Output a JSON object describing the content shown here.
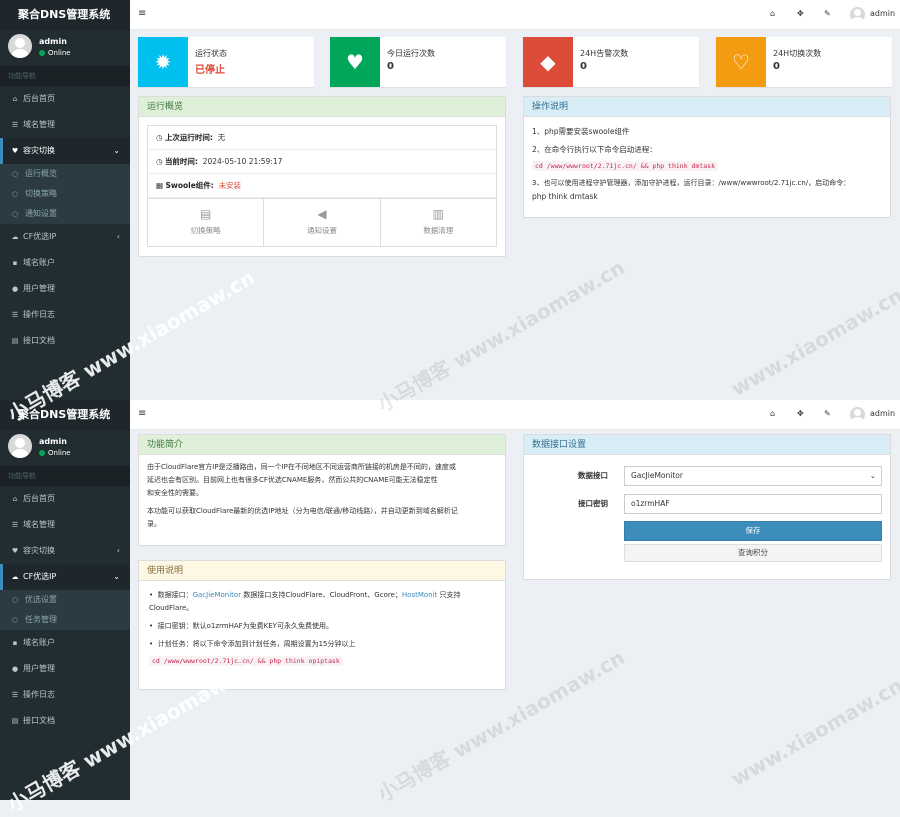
{
  "app": {
    "title": "聚合DNS管理系统",
    "user_name": "admin",
    "user_status": "Online",
    "nav_header": "功能导航",
    "topbar_user": "admin"
  },
  "icons": {
    "menu": "menu-icon",
    "home": "home-icon",
    "fullscreen": "expand-icon",
    "settings": "wrench-icon"
  },
  "screen1": {
    "nav": [
      {
        "label": "后台首页",
        "icon": "home-icon"
      },
      {
        "label": "域名管理",
        "icon": "list-icon"
      },
      {
        "label": "容灾切换",
        "icon": "heart-icon",
        "expanded": true
      },
      {
        "label": "CF优选IP",
        "icon": "cloud-icon"
      },
      {
        "label": "域名账户",
        "icon": "lock-icon"
      },
      {
        "label": "用户管理",
        "icon": "user-icon"
      },
      {
        "label": "操作日志",
        "icon": "list-icon"
      },
      {
        "label": "接口文档",
        "icon": "doc-icon"
      }
    ],
    "subnav": [
      {
        "label": "运行概览",
        "active": true
      },
      {
        "label": "切换策略",
        "active": false
      },
      {
        "label": "通知设置",
        "active": false
      }
    ],
    "info_boxes": [
      {
        "title": "运行状态",
        "value": "已停止",
        "color": "#00c0ef",
        "icon": "gear-icon"
      },
      {
        "title": "今日运行次数",
        "value": "0",
        "color": "#00a65a",
        "icon": "heart-icon"
      },
      {
        "title": "24H告警次数",
        "value": "0",
        "color": "#dd4b39",
        "icon": "ticket-icon"
      },
      {
        "title": "24H切换次数",
        "value": "0",
        "color": "#f39c12",
        "icon": "heart-icon"
      }
    ],
    "overview": {
      "title": "运行概览",
      "last_run_label": "上次运行时间:",
      "last_run_value": "无",
      "current_time_label": "当前时间:",
      "current_time_value": "2024-05-10 21:59:17",
      "swoole_label": "Swoole组件:",
      "swoole_value": "未安装",
      "actions": [
        "切换策略",
        "通知设置",
        "数据清理"
      ]
    },
    "instructions": {
      "title": "操作说明",
      "line1": "1、php需要安装swoole组件",
      "line2": "2、在命令行执行以下命令启动进程：",
      "code": "cd /www/wwwroot/2.71jc.cn/ && php think dmtask",
      "line3": "3、也可以使用进程守护管理器，添加守护进程，运行目录：/www/wwwroot/2.71jc.cn/，启动命令：",
      "line4": "php think dmtask"
    }
  },
  "screen2": {
    "nav": [
      {
        "label": "后台首页"
      },
      {
        "label": "域名管理"
      },
      {
        "label": "容灾切换"
      },
      {
        "label": "CF优选IP",
        "expanded": true
      },
      {
        "label": "域名账户"
      },
      {
        "label": "用户管理"
      },
      {
        "label": "操作日志"
      },
      {
        "label": "接口文档"
      }
    ],
    "subnav": [
      {
        "label": "优选设置",
        "active": true
      },
      {
        "label": "任务管理",
        "active": false
      }
    ],
    "intro": {
      "title": "功能简介",
      "p1_l1": "由于CloudFlare官方IP是泛播路由，同一个IP在不同地区不同运营商所链接的机房是不同的，速度或",
      "p1_l2": "延迟也会有区别。目前网上也有很多CF优选CNAME服务，然而公共的CNAME可能无法稳定性",
      "p1_l3": "和安全性的需要。",
      "p2_l1": "本功能可以获取CloudFlare最新的优选IP地址（分为电信/联通/移动线路），并自动更新到域名解析记",
      "p2_l2": "录。"
    },
    "usage": {
      "title": "使用说明",
      "b1_pre": "数据接口：",
      "b1_link1": "GacJieMonitor",
      "b1_mid": " 数据接口支持CloudFlare、CloudFront、Gcore；",
      "b1_link2": "HostMonit",
      "b1_post": " 只支持",
      "b1_l2": "CloudFlare。",
      "b2": "接口密钥：默认o1zrmHAF为免费KEY可永久免费使用。",
      "b3": "计划任务：将以下命令添加到计划任务，周期设置为15分钟以上",
      "code": "cd /www/wwwroot/2.71jc.cn/ && php think opiptask"
    },
    "settings": {
      "title": "数据接口设置",
      "api_label": "数据接口",
      "api_value": "GacJieMonitor",
      "key_label": "接口密钥",
      "key_value": "o1zrmHAF",
      "save": "保存",
      "query": "查询积分"
    }
  },
  "watermark": {
    "text1": "小马博客 www.xiaomaw.cn",
    "text2": "www.xiaomaw.cn"
  }
}
